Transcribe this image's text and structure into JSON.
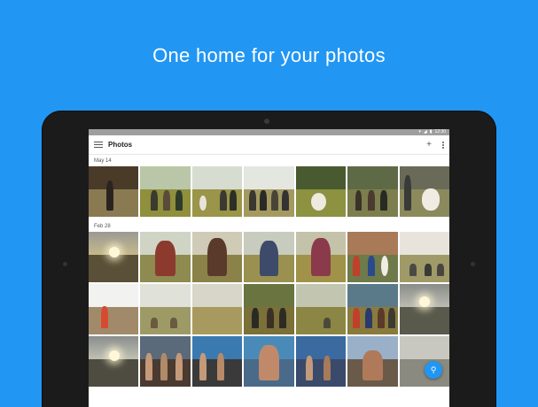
{
  "headline": "One home for your photos",
  "status": {
    "time": "12:30"
  },
  "app": {
    "title": "Photos",
    "add_icon": "add-icon",
    "menu_icon": "hamburger-menu-icon",
    "overflow_icon": "overflow-menu-icon"
  },
  "sections": [
    {
      "date": "May 14"
    },
    {
      "date": "Feb 28"
    }
  ],
  "fab_icon": "search-icon",
  "colors": {
    "background": "#2196f3",
    "accent": "#2196f3"
  }
}
